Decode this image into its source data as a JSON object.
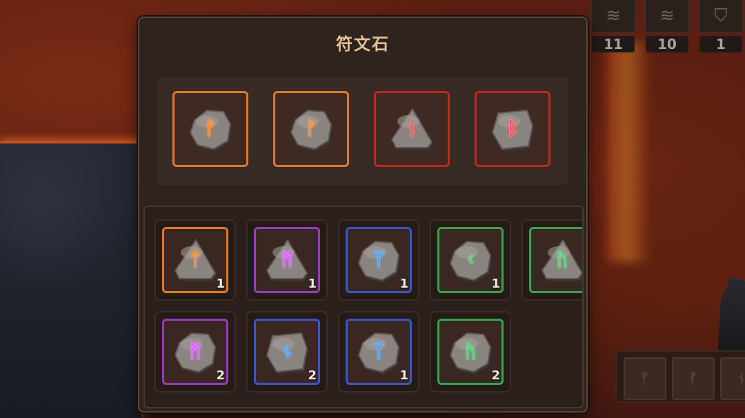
{
  "panel": {
    "title": "符文石"
  },
  "hud": {
    "slots": [
      {
        "icon": "spring-icon",
        "count": "11"
      },
      {
        "icon": "spring-icon",
        "count": "10"
      },
      {
        "icon": "shield-icon",
        "count": "1"
      }
    ]
  },
  "equipped": [
    {
      "glyph": "ᚠ",
      "rarity_color": "#e07a26",
      "glyph_color": "#ff8a2a",
      "stone": "round"
    },
    {
      "glyph": "ᚠ",
      "rarity_color": "#e07a26",
      "glyph_color": "#ff8a2a",
      "stone": "round"
    },
    {
      "glyph": "ᚾ",
      "rarity_color": "#c2271f",
      "glyph_color": "#ff5060",
      "stone": "triangle"
    },
    {
      "glyph": "ᛒ",
      "rarity_color": "#c2271f",
      "glyph_color": "#ff5060",
      "stone": "square"
    }
  ],
  "inventory": [
    {
      "glyph": "ᛏ",
      "count": "1",
      "rarity_color": "#e07a26",
      "glyph_color": "#ff8a2a",
      "stone": "triangle"
    },
    {
      "glyph": "ᛗ",
      "count": "1",
      "rarity_color": "#9a3ac0",
      "glyph_color": "#e060ff",
      "stone": "triangle"
    },
    {
      "glyph": "ᛉ",
      "count": "1",
      "rarity_color": "#3a56c8",
      "glyph_color": "#4aa0ff",
      "stone": "round"
    },
    {
      "glyph": "ᚲ",
      "count": "1",
      "rarity_color": "#32a64a",
      "glyph_color": "#40e070",
      "stone": "round"
    },
    {
      "glyph": "ᚢ",
      "count": "",
      "rarity_color": "#32a64a",
      "glyph_color": "#40e070",
      "stone": "triangle"
    },
    {
      "glyph": "ᛗ",
      "count": "2",
      "rarity_color": "#9a3ac0",
      "glyph_color": "#e060ff",
      "stone": "round"
    },
    {
      "glyph": "ᛃ",
      "count": "2",
      "rarity_color": "#3a56c8",
      "glyph_color": "#4aa0ff",
      "stone": "square"
    },
    {
      "glyph": "ᛉ",
      "count": "1",
      "rarity_color": "#3a56c8",
      "glyph_color": "#4aa0ff",
      "stone": "round"
    },
    {
      "glyph": "ᚢ",
      "count": "2",
      "rarity_color": "#32a64a",
      "glyph_color": "#40e070",
      "stone": "round"
    }
  ],
  "minibar": {
    "slots": [
      {
        "glyph": "ᚠ"
      },
      {
        "glyph": "ᚠ"
      },
      {
        "glyph": "ᚾ"
      }
    ]
  }
}
